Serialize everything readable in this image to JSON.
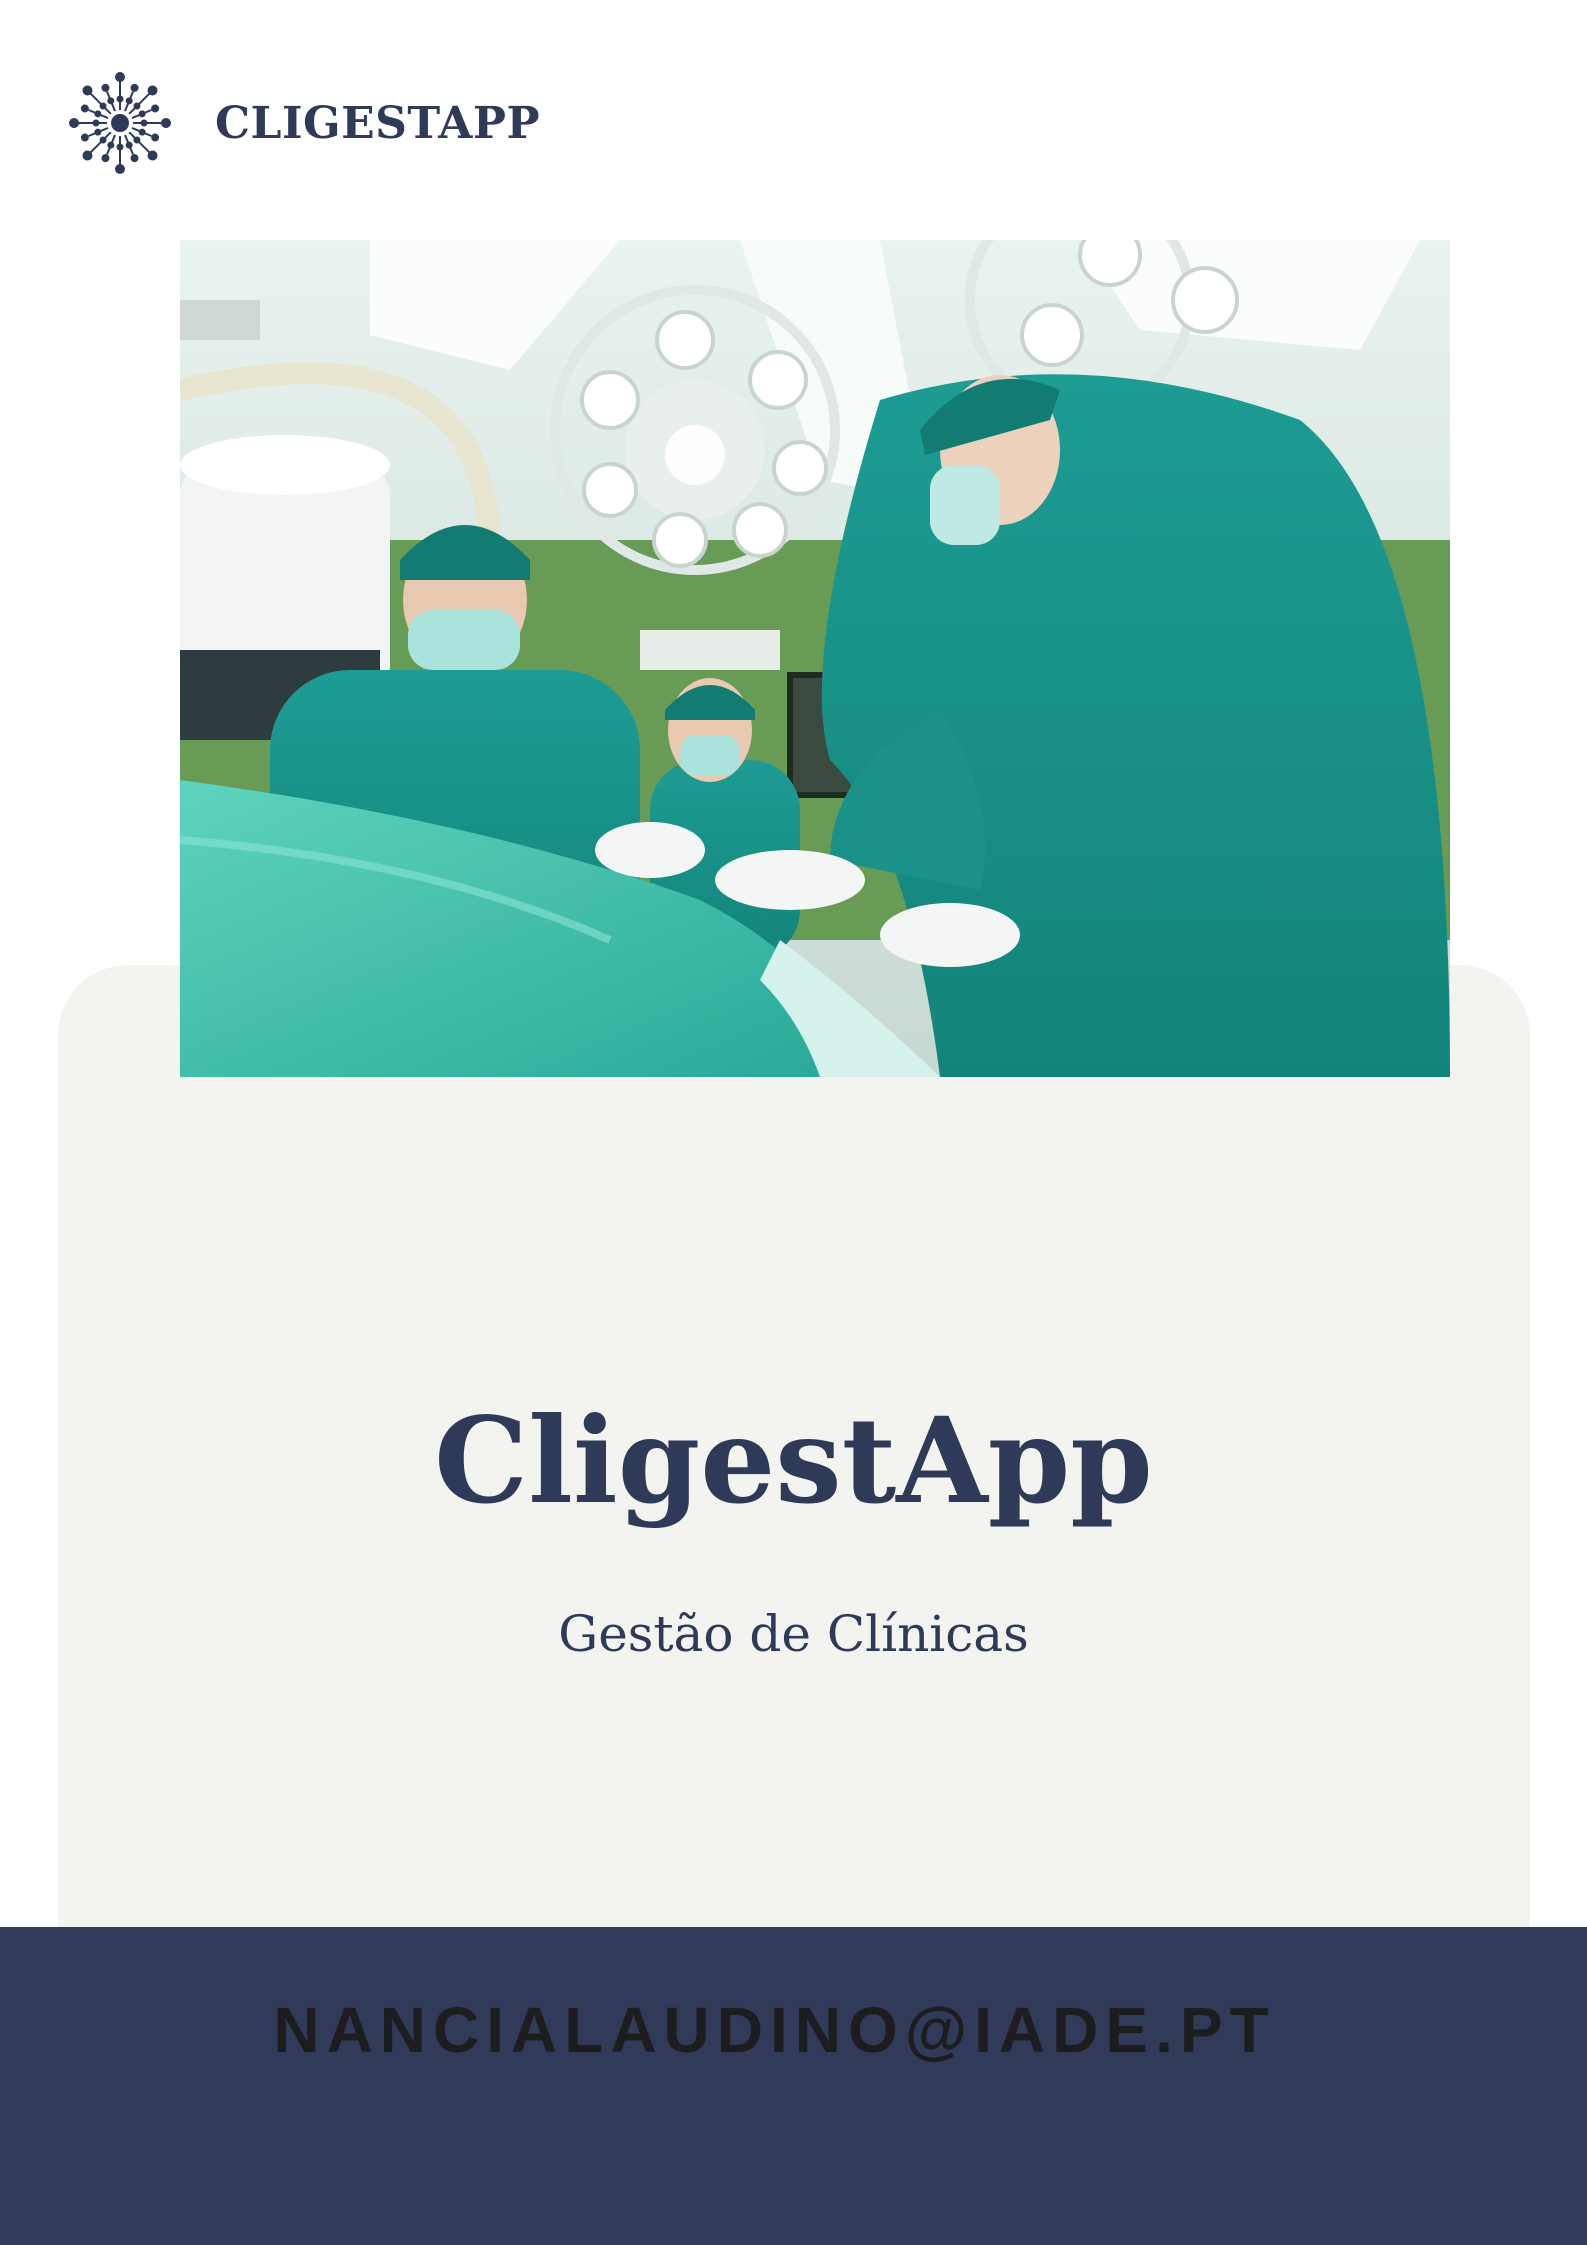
{
  "header": {
    "logo_icon": "snowflake-dot-logo-icon",
    "brand_name": "CLIGESTAPP"
  },
  "hero_image": {
    "description_icon": "surgery-team-photo"
  },
  "main": {
    "title": "CligestApp",
    "subtitle": "Gestão de Clínicas"
  },
  "footer": {
    "email": "NANCIALAUDINO@IADE.PT"
  },
  "colors": {
    "navy": "#2f3a58",
    "footer_bg": "#313a59",
    "panel_bg": "#f3f4ef",
    "scrubs": "#1f9e94"
  }
}
